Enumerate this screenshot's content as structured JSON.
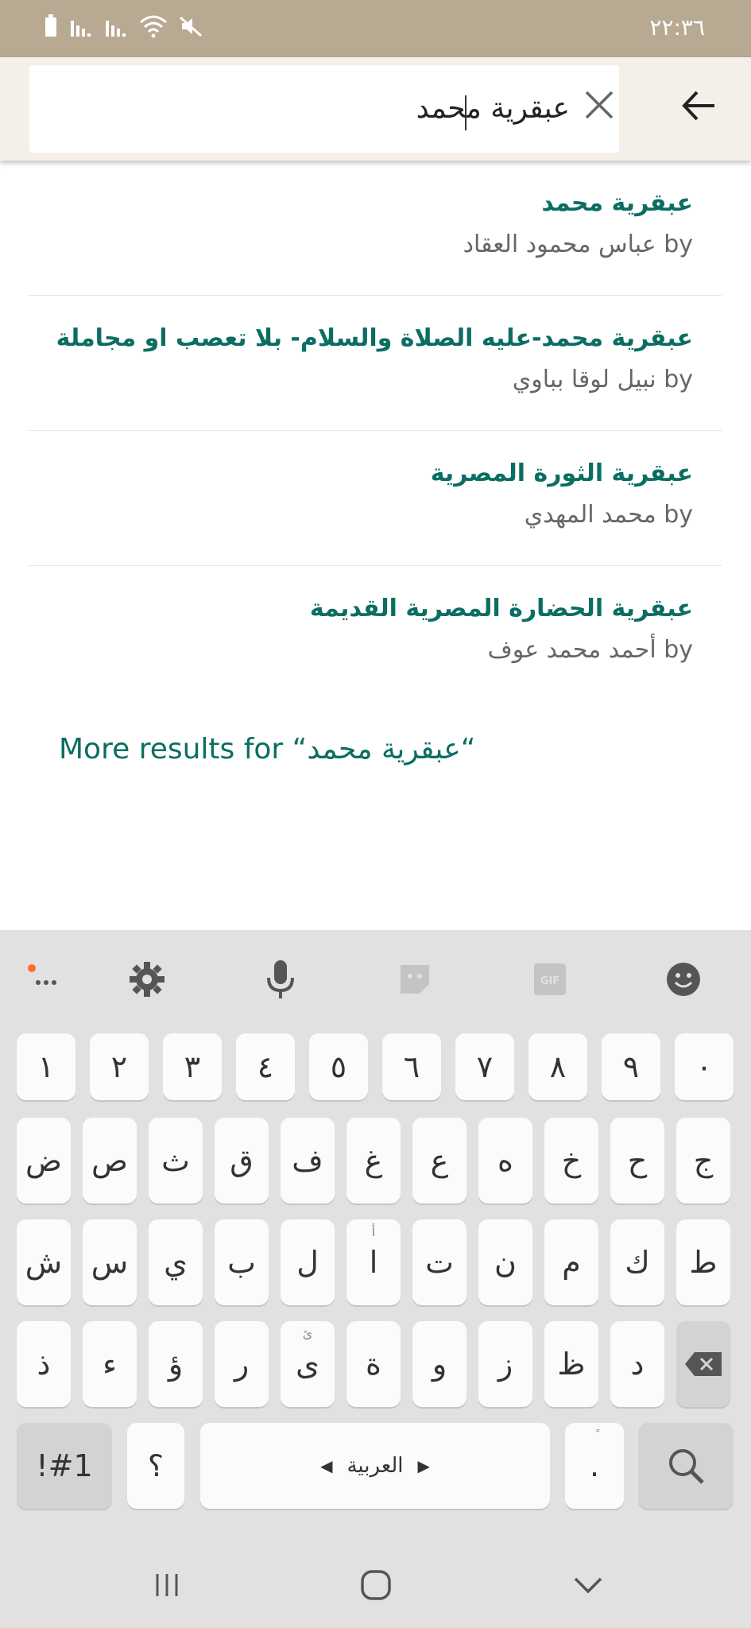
{
  "status_bar": {
    "time": "٢٢:٣٦",
    "icons": [
      "battery-icon",
      "signal-icon",
      "signal-icon",
      "wifi-icon",
      "mute-icon"
    ]
  },
  "search": {
    "query": "عبقرية محمد",
    "clear_icon": "close-icon",
    "back_icon": "arrow-left-icon"
  },
  "results": [
    {
      "title": "عبقرية محمد",
      "author": "by عباس محمود العقاد"
    },
    {
      "title": "عبقرية محمد-عليه الصلاة والسلام- بلا تعصب او مجاملة",
      "author": "by نبيل لوقا بباوي"
    },
    {
      "title": "عبقرية الثورة المصرية",
      "author": "by محمد المهدي"
    },
    {
      "title": "عبقرية الحضارة المصرية القديمة",
      "author": "by أحمد محمد عوف"
    }
  ],
  "more_results": "More results for “عبقرية محمد“",
  "keyboard": {
    "toolbar": [
      "more-options-icon",
      "settings-icon",
      "microphone-icon",
      "sticker-icon",
      "gif-icon",
      "emoji-icon"
    ],
    "number_row": [
      "١",
      "٢",
      "٣",
      "٤",
      "٥",
      "٦",
      "٧",
      "٨",
      "٩",
      "٠"
    ],
    "row1": [
      "ض",
      "ص",
      "ث",
      "ق",
      "ف",
      "غ",
      "ع",
      "ه",
      "خ",
      "ح",
      "ج"
    ],
    "row2": [
      "ش",
      "س",
      "ي",
      "ب",
      "ل",
      "ا",
      "ت",
      "ن",
      "م",
      "ك",
      "ط"
    ],
    "row2_hints": {
      "5": "أ"
    },
    "row3": [
      "ذ",
      "ء",
      "ؤ",
      "ر",
      "ى",
      "ة",
      "و",
      "ز",
      "ظ",
      "د"
    ],
    "row3_hints": {
      "4": "ئ"
    },
    "symbols_label": "!#1",
    "question_label": "؟",
    "space_label": "العربية",
    "period_label": ".",
    "period_hint": "ً"
  },
  "nav": [
    "recents-icon",
    "home-icon",
    "back-chevron-icon"
  ]
}
